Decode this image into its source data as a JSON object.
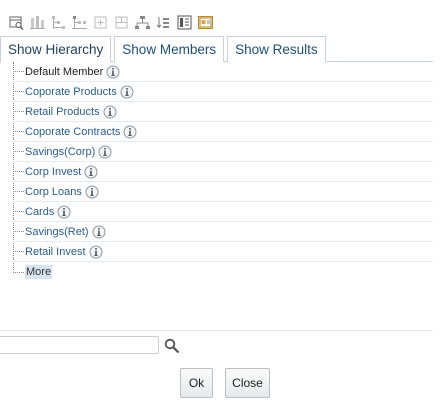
{
  "toolbar": {
    "buttons": [
      {
        "name": "find-member-icon"
      },
      {
        "name": "expand-all-icon"
      },
      {
        "name": "expand-branch-icon"
      },
      {
        "name": "collapse-branch-icon"
      },
      {
        "name": "expand-node-icon"
      },
      {
        "name": "collapse-node-icon"
      },
      {
        "name": "move-member-icon"
      },
      {
        "name": "reorder-icon"
      },
      {
        "name": "show-code-icon"
      },
      {
        "name": "show-properties-icon"
      }
    ]
  },
  "tabs": [
    {
      "label": "Show Hierarchy",
      "active": true
    },
    {
      "label": "Show Members",
      "active": false
    },
    {
      "label": "Show Results",
      "active": false
    }
  ],
  "tree": {
    "items": [
      {
        "label": "Default Member",
        "link": false,
        "info": true
      },
      {
        "label": "Coporate Products",
        "link": true,
        "info": true
      },
      {
        "label": "Retail Products",
        "link": true,
        "info": true
      },
      {
        "label": "Coporate Contracts",
        "link": true,
        "info": true
      },
      {
        "label": "Savings(Corp)",
        "link": true,
        "info": true
      },
      {
        "label": "Corp Invest",
        "link": true,
        "info": true
      },
      {
        "label": "Corp Loans",
        "link": true,
        "info": true
      },
      {
        "label": "Cards",
        "link": true,
        "info": true
      },
      {
        "label": "Savings(Ret)",
        "link": true,
        "info": true
      },
      {
        "label": "Retail Invest",
        "link": true,
        "info": true
      }
    ],
    "more_label": "More"
  },
  "search": {
    "value": "",
    "placeholder": ""
  },
  "buttons": {
    "ok_label": "Ok",
    "close_label": "Close"
  },
  "colors": {
    "link": "#2a5d8f",
    "tab_text": "#1f4f7a",
    "more_highlight": "#d7e4ef"
  }
}
